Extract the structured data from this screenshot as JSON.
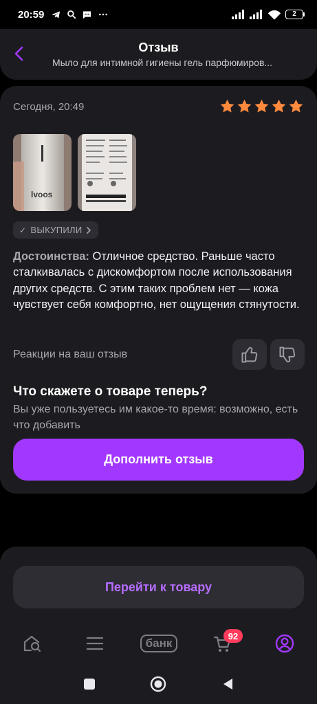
{
  "status_bar": {
    "time": "20:59",
    "battery": "2"
  },
  "header": {
    "title": "Отзыв",
    "subtitle": "Мыло для интимной гигиены гель парфюмиров..."
  },
  "review": {
    "date": "Сегодня, 20:49",
    "rating": 5,
    "badge": "ВЫКУПИЛИ",
    "pros_label": "Достоинства:",
    "pros_text": " Отличное средство. Раньше часто сталкивалась с дискомфортом после использования других средств. С этим таких проблем нет — кожа чувствует себя комфортно, нет ощущения стянутости.",
    "photo_logo": "lvoos",
    "reactions_label": "Реакции на ваш отзыв"
  },
  "prompt": {
    "title": "Что скажете о товаре теперь?",
    "text": "Вы уже пользуетесь им какое-то время: возможно, есть что добавить"
  },
  "buttons": {
    "add_review": "Дополнить отзыв",
    "go_to_product": "Перейти к товару"
  },
  "tabbar": {
    "bank_label": "банк",
    "cart_count": "92"
  },
  "colors": {
    "accent": "#a238ff",
    "accent_text": "#b66cff",
    "star": "#ff8a3d",
    "badge": "#ff3b5c",
    "card": "#1c1c20"
  }
}
